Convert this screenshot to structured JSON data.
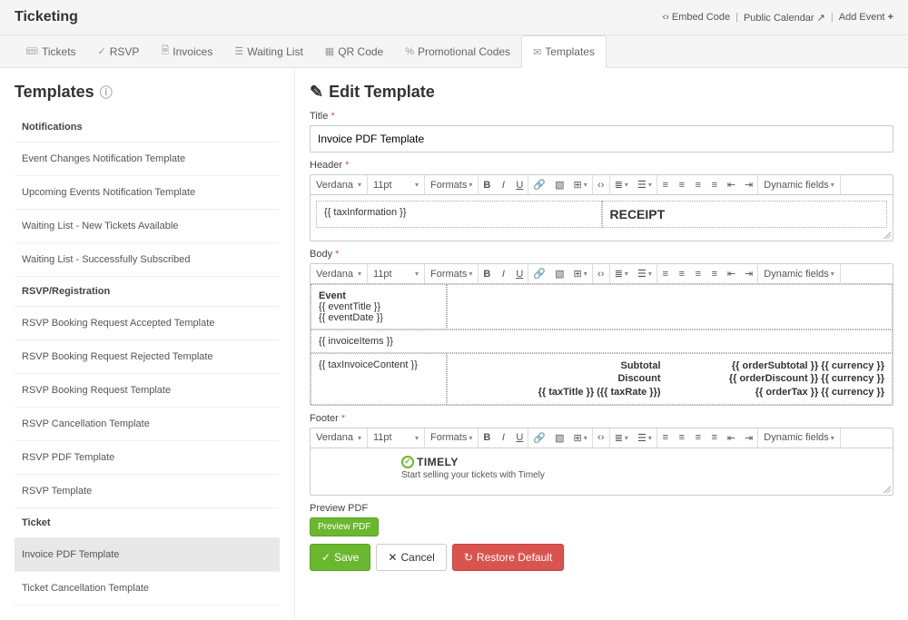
{
  "header": {
    "title": "Ticketing",
    "links": {
      "embed": "Embed Code",
      "calendar": "Public Calendar",
      "add_event": "Add Event"
    }
  },
  "tabs": [
    {
      "icon": "🎟",
      "label": "Tickets"
    },
    {
      "icon": "✓",
      "label": "RSVP"
    },
    {
      "icon": "🗎",
      "label": "Invoices"
    },
    {
      "icon": "☰",
      "label": "Waiting List"
    },
    {
      "icon": "▦",
      "label": "QR Code"
    },
    {
      "icon": "%",
      "label": "Promotional Codes"
    },
    {
      "icon": "✉",
      "label": "Templates",
      "active": true
    }
  ],
  "sidebar": {
    "title": "Templates",
    "sections": [
      {
        "header": "Notifications",
        "items": [
          "Event Changes Notification Template",
          "Upcoming Events Notification Template",
          "Waiting List - New Tickets Available",
          "Waiting List - Successfully Subscribed"
        ]
      },
      {
        "header": "RSVP/Registration",
        "items": [
          "RSVP Booking Request Accepted Template",
          "RSVP Booking Request Rejected Template",
          "RSVP Booking Request Template",
          "RSVP Cancellation Template",
          "RSVP PDF Template",
          "RSVP Template"
        ]
      },
      {
        "header": "Ticket",
        "items": [
          "Invoice PDF Template",
          "Ticket Cancellation Template"
        ],
        "active_index": 0
      }
    ]
  },
  "main": {
    "title": "Edit Template",
    "title_label": "Title",
    "title_value": "Invoice PDF Template",
    "header_label": "Header",
    "body_label": "Body",
    "footer_label": "Footer",
    "preview_label": "Preview PDF",
    "toolbar": {
      "font": "Verdana",
      "size": "11pt",
      "formats": "Formats",
      "dynamic": "Dynamic fields"
    },
    "header_editor": {
      "left": "{{ taxInformation }}",
      "right": "RECEIPT"
    },
    "body_editor": {
      "event_label": "Event",
      "event_title": "{{ eventTitle }}",
      "event_date": "{{ eventDate }}",
      "invoice_items": "{{ invoiceItems }}",
      "tax_invoice": "{{ taxInvoiceContent }}",
      "totals_left": [
        "Subtotal",
        "Discount",
        "{{ taxTitle }} ({{ taxRate }})"
      ],
      "totals_right": [
        "{{ orderSubtotal }} {{ currency }}",
        "{{ orderDiscount }} {{ currency }}",
        "{{ orderTax }} {{ currency }}"
      ]
    },
    "footer_editor": {
      "logo": "TIMELY",
      "sub": "Start selling your tickets with Timely"
    },
    "buttons": {
      "preview": "Preview PDF",
      "save": "Save",
      "cancel": "Cancel",
      "restore": "Restore Default"
    }
  }
}
